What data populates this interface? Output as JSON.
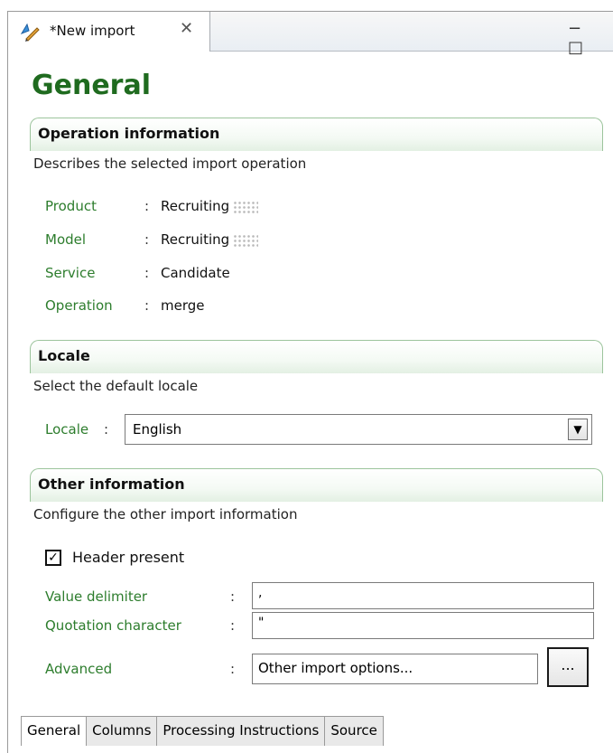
{
  "editor": {
    "tab_title": "*New import",
    "tab_close_icon": "close-icon",
    "window_buttons": "− □"
  },
  "page_title": "General",
  "operation": {
    "header": "Operation information",
    "description": "Describes the selected import operation",
    "rows": [
      {
        "key": "Product",
        "value": "Recruiting"
      },
      {
        "key": "Model",
        "value": "Recruiting"
      },
      {
        "key": "Service",
        "value": "Candidate"
      },
      {
        "key": "Operation",
        "value": "merge"
      }
    ]
  },
  "locale": {
    "header": "Locale",
    "description": "Select the default locale",
    "label": "Locale",
    "selected": "English"
  },
  "other": {
    "header": "Other information",
    "description": "Configure the other import information",
    "header_present_label": "Header present",
    "header_present_checked": true,
    "value_delimiter_label": "Value delimiter",
    "value_delimiter": ",",
    "quotation_label": "Quotation character",
    "quotation": "\"",
    "advanced_label": "Advanced",
    "advanced_value": "Other import options...",
    "browse_label": "..."
  },
  "bottom_tabs": [
    "General",
    "Columns",
    "Processing Instructions",
    "Source"
  ],
  "active_bottom_tab": "General"
}
